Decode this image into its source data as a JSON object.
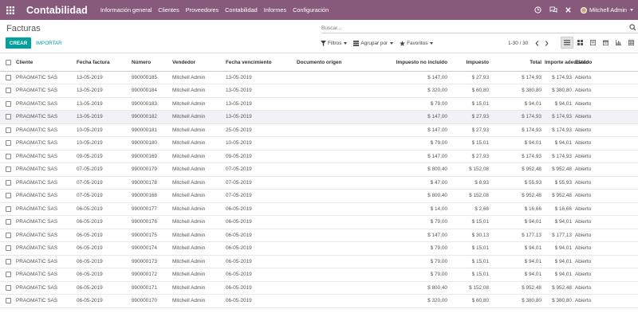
{
  "topbar": {
    "brand": "Contabilidad",
    "menu": [
      "Información general",
      "Clientes",
      "Proveedores",
      "Contabilidad",
      "Informes",
      "Configuración"
    ],
    "user": "Mitchell Admin"
  },
  "control": {
    "breadcrumb": "Facturas",
    "search_placeholder": "Buscar...",
    "create_label": "CREAR",
    "import_label": "IMPORTAR",
    "filters_label": "Filtros",
    "groupby_label": "Agrupar por",
    "favorites_label": "Favoritos",
    "pager": "1-30 / 30"
  },
  "table": {
    "headers": [
      "Cliente",
      "Fecha factura",
      "Número",
      "Vendedor",
      "Fecha vencimiento",
      "Documento origen",
      "Impuesto no incluido",
      "Impuesto",
      "Total",
      "Importe adeudado",
      "Estado"
    ],
    "rows": [
      [
        "PRAGMATIC SAS",
        "13-05-2019",
        "990000185",
        "Mitchell Admin",
        "13-05-2019",
        "",
        "$ 147,00",
        "$ 27,93",
        "$ 174,93",
        "$ 174,93",
        "Abierto"
      ],
      [
        "PRAGMATIC SAS",
        "13-05-2019",
        "990000184",
        "Mitchell Admin",
        "13-05-2019",
        "",
        "$ 320,00",
        "$ 60,80",
        "$ 380,80",
        "$ 380,80",
        "Abierto"
      ],
      [
        "PRAGMATIC SAS",
        "13-05-2019",
        "990000183",
        "Mitchell Admin",
        "13-05-2019",
        "",
        "$ 79,00",
        "$ 15,01",
        "$ 94,01",
        "$ 94,01",
        "Abierto"
      ],
      [
        "PRAGMATIC SAS",
        "13-05-2019",
        "990000182",
        "Mitchell Admin",
        "13-05-2019",
        "",
        "$ 147,00",
        "$ 27,93",
        "$ 174,93",
        "$ 174,93",
        "Abierto"
      ],
      [
        "PRAGMATIC SAS",
        "10-05-2019",
        "990000181",
        "Mitchell Admin",
        "25-05-2019",
        "",
        "$ 147,00",
        "$ 27,93",
        "$ 174,93",
        "$ 174,93",
        "Abierto"
      ],
      [
        "PRAGMATIC SAS",
        "10-05-2019",
        "990000180",
        "Mitchell Admin",
        "10-05-2019",
        "",
        "$ 79,00",
        "$ 15,01",
        "$ 94,01",
        "$ 94,01",
        "Abierto"
      ],
      [
        "PRAGMATIC SAS",
        "09-05-2019",
        "990000169",
        "Mitchell Admin",
        "09-05-2019",
        "",
        "$ 147,00",
        "$ 27,93",
        "$ 174,93",
        "$ 174,93",
        "Abierto"
      ],
      [
        "PRAGMATIC SAS",
        "07-05-2019",
        "990000179",
        "Mitchell Admin",
        "07-05-2019",
        "",
        "$ 800,40",
        "$ 152,08",
        "$ 952,48",
        "$ 952,48",
        "Abierto"
      ],
      [
        "PRAGMATIC SAS",
        "07-05-2019",
        "990000178",
        "Mitchell Admin",
        "07-05-2019",
        "",
        "$ 47,00",
        "$ 8,93",
        "$ 55,93",
        "$ 55,93",
        "Abierto"
      ],
      [
        "PRAGMATIC SAS",
        "07-05-2019",
        "990000168",
        "Mitchell Admin",
        "07-05-2019",
        "",
        "$ 800,40",
        "$ 152,08",
        "$ 952,48",
        "$ 952,48",
        "Abierto"
      ],
      [
        "PRAGMATIC SAS",
        "06-05-2019",
        "990000177",
        "Mitchell Admin",
        "06-05-2019",
        "",
        "$ 14,00",
        "$ 2,66",
        "$ 16,66",
        "$ 16,66",
        "Abierto"
      ],
      [
        "PRAGMATIC SAS",
        "06-05-2019",
        "990000176",
        "Mitchell Admin",
        "06-05-2019",
        "",
        "$ 79,00",
        "$ 15,01",
        "$ 94,01",
        "$ 94,01",
        "Abierto"
      ],
      [
        "PRAGMATIC SAS",
        "06-05-2019",
        "990000175",
        "Mitchell Admin",
        "06-05-2019",
        "",
        "$ 147,00",
        "$ 30,13",
        "$ 177,13",
        "$ 177,13",
        "Abierto"
      ],
      [
        "PRAGMATIC SAS",
        "06-05-2019",
        "990000174",
        "Mitchell Admin",
        "06-05-2019",
        "",
        "$ 79,00",
        "$ 15,01",
        "$ 94,01",
        "$ 94,01",
        "Abierto"
      ],
      [
        "PRAGMATIC SAS",
        "06-05-2019",
        "990000173",
        "Mitchell Admin",
        "06-05-2019",
        "",
        "$ 79,00",
        "$ 15,01",
        "$ 94,01",
        "$ 94,01",
        "Abierto"
      ],
      [
        "PRAGMATIC SAS",
        "06-05-2019",
        "990000172",
        "Mitchell Admin",
        "06-05-2019",
        "",
        "$ 79,00",
        "$ 15,01",
        "$ 94,01",
        "$ 94,01",
        "Abierto"
      ],
      [
        "PRAGMATIC SAS",
        "06-05-2019",
        "990000171",
        "Mitchell Admin",
        "06-05-2019",
        "",
        "$ 800,40",
        "$ 152,08",
        "$ 952,48",
        "$ 952,48",
        "Abierto"
      ],
      [
        "PRAGMATIC SAS",
        "06-05-2019",
        "990000170",
        "Mitchell Admin",
        "06-05-2019",
        "",
        "$ 320,00",
        "$ 60,80",
        "$ 380,80",
        "$ 380,80",
        "Abierto"
      ]
    ],
    "hover_row": 3
  },
  "icons": {
    "apps": "apps-grid-icon",
    "clock": "clock-icon",
    "chat": "chat-icon",
    "debug": "debug-icon",
    "search": "search-icon",
    "views": [
      "list-view-icon",
      "kanban-view-icon",
      "form-view-icon",
      "calendar-view-icon",
      "graph-view-icon",
      "pivot-view-icon",
      "activity-view-icon"
    ]
  },
  "colors": {
    "topbar": "#875a7b",
    "primary": "#00a09d"
  }
}
